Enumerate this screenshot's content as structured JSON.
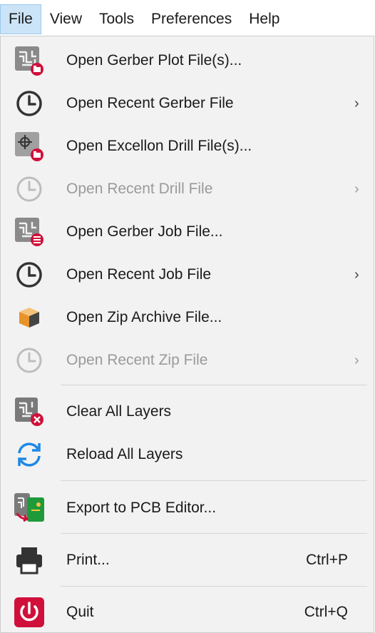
{
  "menubar": {
    "items": [
      "File",
      "View",
      "Tools",
      "Preferences",
      "Help"
    ]
  },
  "file_menu": {
    "items": [
      {
        "label": "Open Gerber Plot File(s)...",
        "icon": "open-gerber-icon"
      },
      {
        "label": "Open Recent Gerber File",
        "icon": "clock-icon",
        "submenu": "›"
      },
      {
        "label": "Open Excellon Drill File(s)...",
        "icon": "open-drill-icon"
      },
      {
        "label": "Open Recent Drill File",
        "icon": "clock-icon",
        "submenu": "›",
        "disabled": true
      },
      {
        "label": "Open Gerber Job File...",
        "icon": "open-job-icon"
      },
      {
        "label": "Open Recent Job File",
        "icon": "clock-icon",
        "submenu": "›"
      },
      {
        "label": "Open Zip Archive File...",
        "icon": "zip-archive-icon"
      },
      {
        "label": "Open Recent Zip File",
        "icon": "clock-icon",
        "submenu": "›",
        "disabled": true
      },
      {
        "label": "Clear All Layers",
        "icon": "clear-layers-icon"
      },
      {
        "label": "Reload All Layers",
        "icon": "reload-icon"
      },
      {
        "label": "Export to PCB Editor...",
        "icon": "export-pcb-icon"
      },
      {
        "label": "Print...",
        "icon": "printer-icon",
        "shortcut": "Ctrl+P"
      },
      {
        "label": "Quit",
        "icon": "power-icon",
        "shortcut": "Ctrl+Q"
      }
    ]
  },
  "colors": {
    "active_menu_bg": "#cce4f7",
    "menu_bg": "#f2f2f2",
    "disabled_text": "#9a9a9a",
    "accent_red": "#d0103a",
    "reload_blue": "#1e88e5"
  }
}
